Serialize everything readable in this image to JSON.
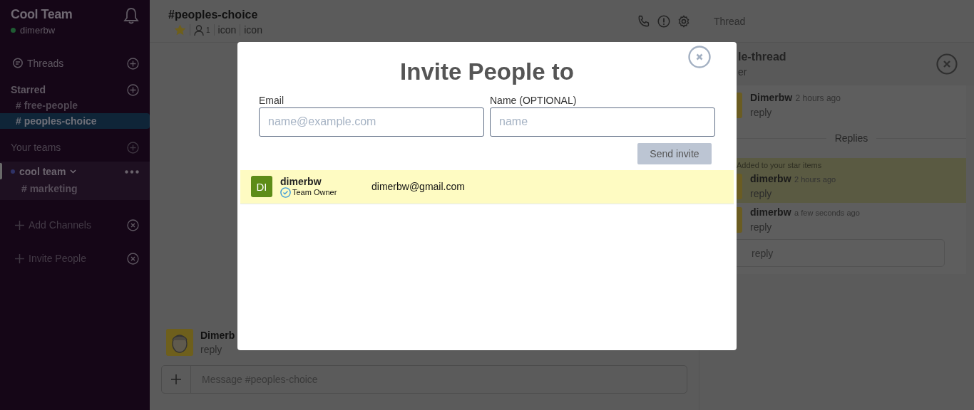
{
  "sidebar": {
    "team_name": "Cool Team",
    "user": {
      "name": "dimerbw",
      "online": true
    },
    "threads_label": "Threads",
    "starred": {
      "title": "Starred",
      "channels": [
        {
          "label": "# free-people",
          "selected": false
        },
        {
          "label": "# peoples-choice",
          "selected": true
        }
      ]
    },
    "teams": {
      "title": "Your teams",
      "items": [
        {
          "name": "cool team",
          "expanded": true,
          "channels": [
            "# marketing"
          ]
        }
      ]
    },
    "actions": [
      "Add Channels",
      "Invite People"
    ]
  },
  "channel_header": {
    "title": "#peoples-choice",
    "starred": true,
    "member_count": "1",
    "links": [
      "icon",
      "icon"
    ],
    "thread_label": "Thread"
  },
  "messages": [
    {
      "author": "Dimerb",
      "text": "reply"
    }
  ],
  "composer": {
    "placeholder": "Message #peoples-choice"
  },
  "thread_panel": {
    "title": "le-thread",
    "subtitle": "er",
    "parent": {
      "author": "Dimerbw",
      "time": "2 hours ago",
      "text": "reply"
    },
    "divider": "Replies",
    "replies": [
      {
        "author": "dimerbw",
        "time": "2 hours ago",
        "text": "reply",
        "highlighted": true,
        "notice": "Added to your star items"
      },
      {
        "author": "dimerbw",
        "time": "a few seconds ago",
        "text": "reply",
        "highlighted": false
      }
    ],
    "reply_box": {
      "placeholder": "reply"
    }
  },
  "modal": {
    "title": "Invite People to",
    "fields": [
      {
        "label": "Email",
        "placeholder": "name@example.com"
      },
      {
        "label": "Name (OPTIONAL)",
        "placeholder": "name"
      }
    ],
    "submit": "Send invite",
    "members": [
      {
        "initials": "DI",
        "name": "dimerbw",
        "role": "Team Owner",
        "email": "dimerbw@gmail.com",
        "selected": true
      }
    ]
  }
}
